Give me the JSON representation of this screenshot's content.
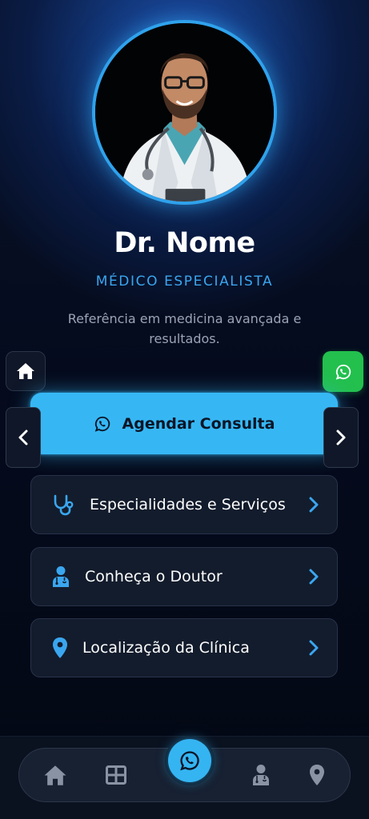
{
  "profile": {
    "name": "Dr. Nome",
    "specialty": "MÉDICO ESPECIALISTA",
    "tagline": "Referência em medicina avançada e resultados.",
    "photo": "doctor-portrait"
  },
  "floating": {
    "home_icon": "home-icon",
    "whatsapp_icon": "whatsapp-icon",
    "prev_icon": "chevron-left-icon",
    "next_icon": "chevron-right-icon"
  },
  "cta": {
    "label": "Agendar Consulta",
    "icon": "whatsapp-icon"
  },
  "menu": {
    "items": [
      {
        "label": "Especialidades e Serviços",
        "icon": "stethoscope-icon"
      },
      {
        "label": "Conheça o Doutor",
        "icon": "doctor-icon"
      },
      {
        "label": "Localização da Clínica",
        "icon": "map-pin-icon"
      }
    ]
  },
  "bottom_nav": {
    "items": [
      "home-icon",
      "grid-icon",
      "whatsapp-icon",
      "doctor-icon",
      "map-pin-icon"
    ]
  },
  "colors": {
    "accent": "#36b7f4",
    "accent_text": "#3aa6ef",
    "whatsapp": "#23c04e",
    "card_bg": "#131c2c",
    "background": "#050b1d"
  }
}
